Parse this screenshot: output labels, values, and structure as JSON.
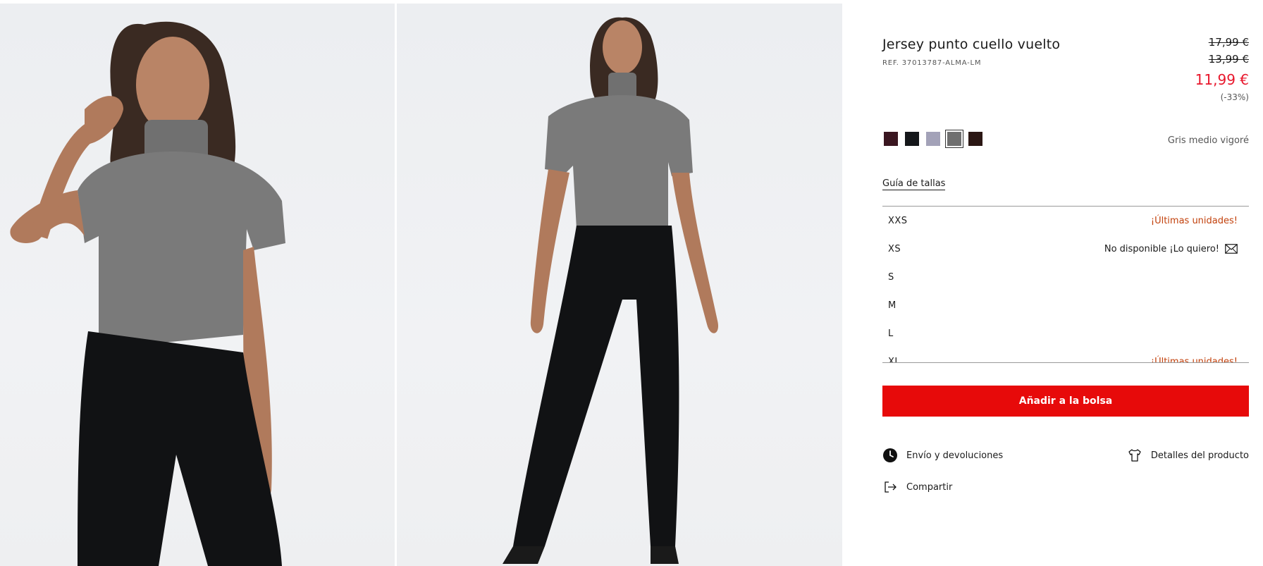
{
  "product": {
    "title": "Jersey punto cuello vuelto",
    "ref": "REF. 37013787-ALMA-LM",
    "price_original": "17,99 €",
    "price_previous": "13,99 €",
    "price_current": "11,99 €",
    "discount": "(-33%)"
  },
  "colors": {
    "swatches": [
      {
        "name": "burgundy",
        "hex": "#3a1620"
      },
      {
        "name": "black",
        "hex": "#15171a"
      },
      {
        "name": "lavender-grey",
        "hex": "#a3a2b8"
      },
      {
        "name": "grey",
        "hex": "#6f6f6f"
      },
      {
        "name": "dark-brown",
        "hex": "#2b1714"
      }
    ],
    "selected_index": 3,
    "selected_label": "Gris medio vigoré"
  },
  "sizes": {
    "guide_label": "Guía de tallas",
    "items": [
      {
        "label": "XXS",
        "status": "¡Últimas unidades!"
      },
      {
        "label": "XS",
        "status": "No disponible ¡Lo quiero!"
      },
      {
        "label": "S",
        "status": ""
      },
      {
        "label": "M",
        "status": ""
      },
      {
        "label": "L",
        "status": ""
      },
      {
        "label": "XL",
        "status": "¡Últimas unidades!"
      }
    ]
  },
  "actions": {
    "add_to_bag": "Añadir a la bolsa",
    "shipping": "Envío y devoluciones",
    "details": "Detalles del producto",
    "share": "Compartir"
  },
  "icons": {
    "shipping": "clock-icon",
    "details": "tshirt-icon",
    "share": "share-icon",
    "notify": "envelope-icon"
  },
  "theme": {
    "accent": "#e70a0a",
    "sale_price": "#e8172c",
    "stock_warning": "#c2410c"
  }
}
